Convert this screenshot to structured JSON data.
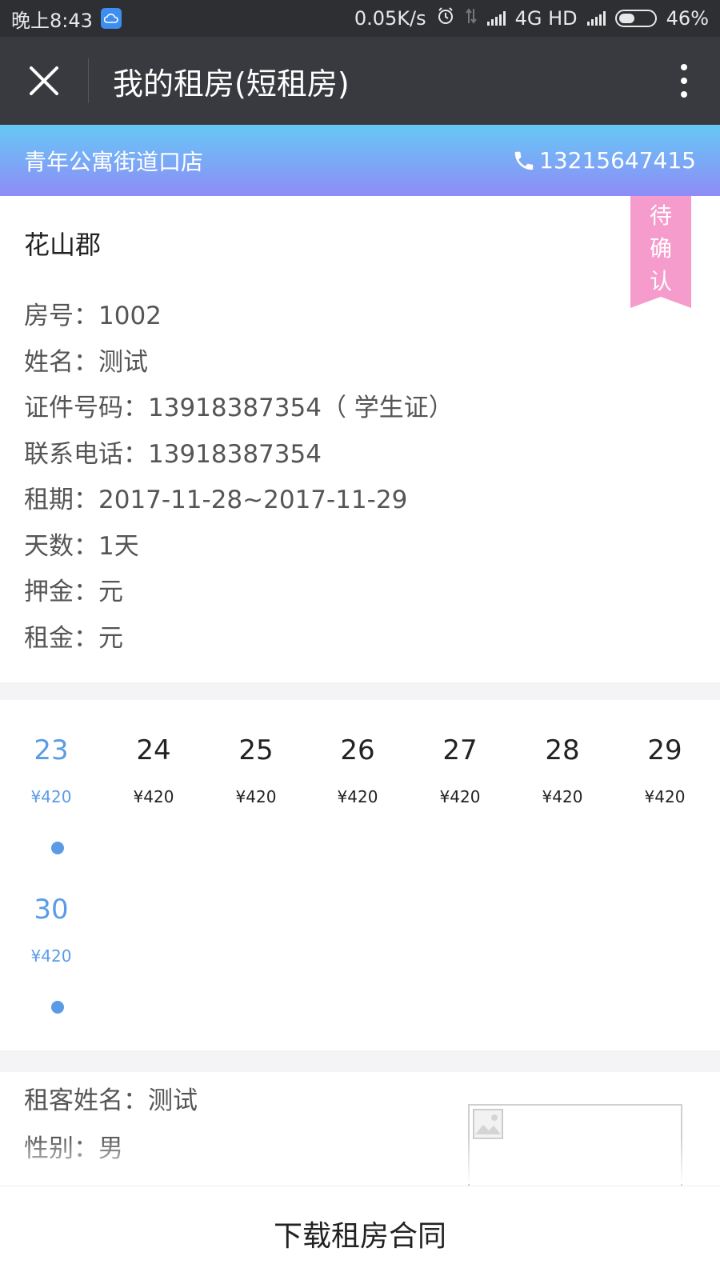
{
  "status_bar": {
    "time": "晚上8:43",
    "net_speed": "0.05K/s",
    "network": "4G HD",
    "battery_text": "46%",
    "battery_level": 0.46
  },
  "title_bar": {
    "title": "我的租房(短租房)"
  },
  "store": {
    "name": "青年公寓街道口店",
    "phone": "13215647415"
  },
  "booking": {
    "estate": "花山郡",
    "status": [
      "待",
      "确",
      "认"
    ],
    "fields": [
      "房号：1002",
      "姓名：测试",
      "证件号码：13918387354（ 学生证）",
      "联系电话：13918387354",
      "租期：2017-11-28~2017-11-29",
      "天数：1天",
      "押金：元",
      "租金：元"
    ]
  },
  "calendar": {
    "days": [
      {
        "day": "23",
        "price": "¥420",
        "active": true
      },
      {
        "day": "24",
        "price": "¥420",
        "active": false
      },
      {
        "day": "25",
        "price": "¥420",
        "active": false
      },
      {
        "day": "26",
        "price": "¥420",
        "active": false
      },
      {
        "day": "27",
        "price": "¥420",
        "active": false
      },
      {
        "day": "28",
        "price": "¥420",
        "active": false
      },
      {
        "day": "29",
        "price": "¥420",
        "active": false
      },
      {
        "day": "30",
        "price": "¥420",
        "active": true
      }
    ],
    "accent_color": "#5b9be6"
  },
  "tenant": {
    "name": "租客姓名：测试",
    "gender": "性别：男"
  },
  "footer": {
    "download_label": "下载租房合同"
  }
}
